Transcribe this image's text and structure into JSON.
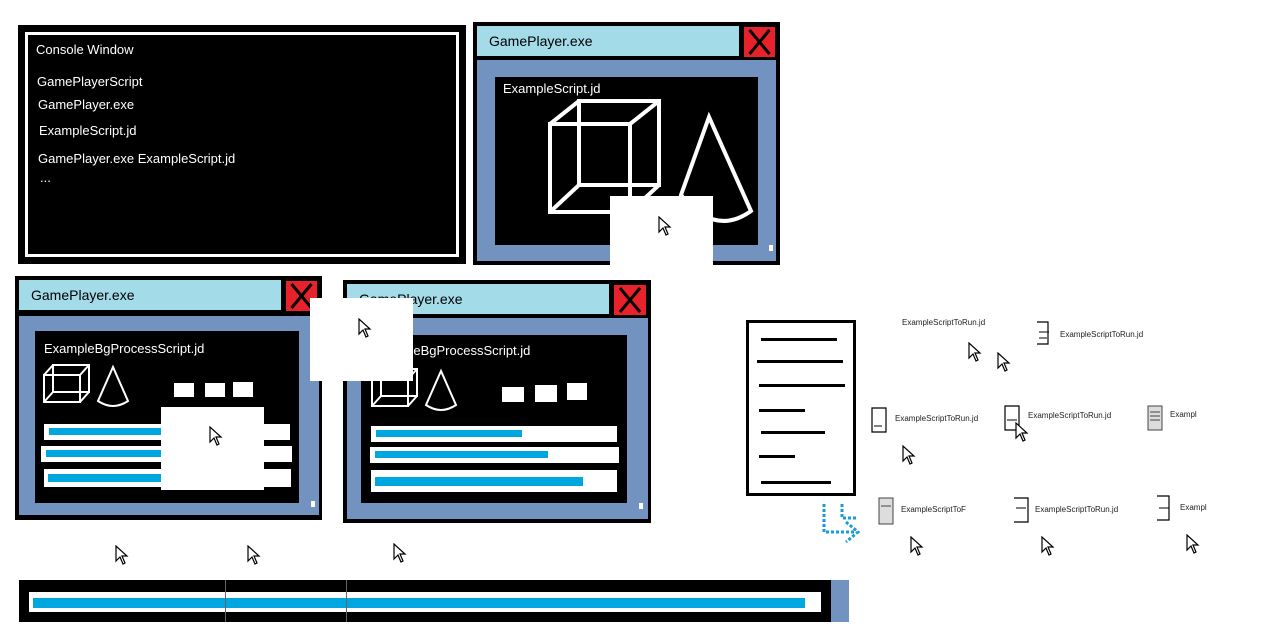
{
  "console": {
    "title": "Console Window",
    "lines": [
      "GamePlayerScript",
      "GamePlayer.exe",
      "ExampleScript.jd",
      "GamePlayer.exe ExampleScript.jd",
      "..."
    ]
  },
  "window_top": {
    "title": "GamePlayer.exe",
    "script": "ExampleScript.jd"
  },
  "window_left": {
    "title": "GamePlayer.exe",
    "script": "ExampleBgProcessScript.jd",
    "progress": [
      0.5,
      0.66,
      0.78
    ]
  },
  "window_mid": {
    "title": "GamePlayer.exe",
    "script": "ExampleBgProcessScript.jd",
    "progress": [
      0.62,
      0.72,
      0.88
    ]
  },
  "files": [
    "ExampleScriptToRun.jd",
    "ExampleScriptToRun.jd",
    "ExampleScriptToRun.jd",
    "ExampleScriptToRun.jd",
    "Exampl",
    "ExampleScriptToF",
    "ExampleScriptToRun.jd",
    "Exampl"
  ],
  "taskbar": {
    "progress": 0.97
  },
  "colors": {
    "title_bar": "#a3dbe9",
    "frame": "#7293bf",
    "close": "#e8222b",
    "progress": "#00a6e0"
  }
}
